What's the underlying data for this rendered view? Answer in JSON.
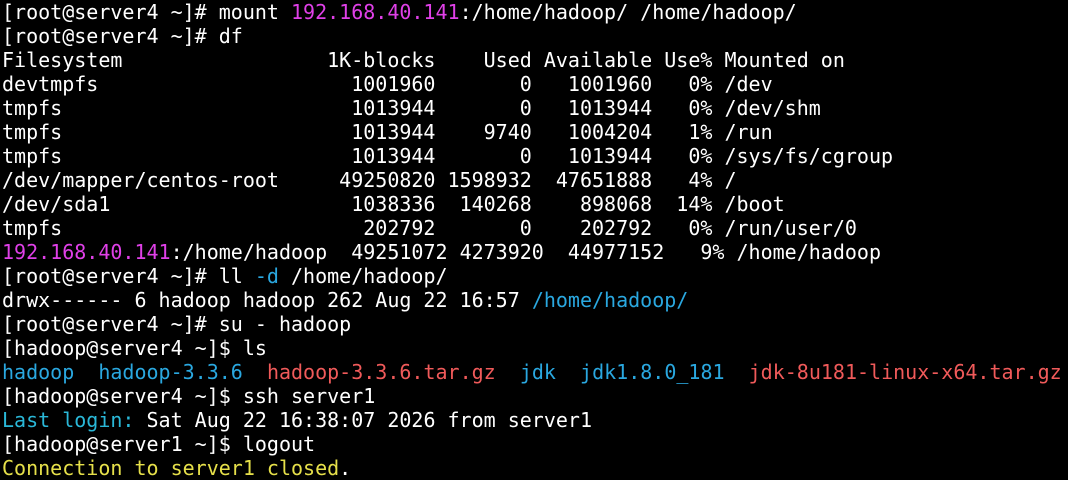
{
  "colors": {
    "background": "#000000",
    "foreground": "#ffffff",
    "ip_magenta": "#e040e8",
    "dir_blue": "#2aa8e0",
    "archive_red": "#f05a5a",
    "notice_yellow": "#e6e04a"
  },
  "lines": {
    "l1_prompt": "[root@server4 ~]# mount ",
    "l1_ip": "192.168.40.141",
    "l1_rest": ":/home/hadoop/ /home/hadoop/",
    "l2": "[root@server4 ~]# df",
    "l3": "Filesystem                 1K-blocks    Used Available Use% Mounted on",
    "l4": "devtmpfs                     1001960       0   1001960   0% /dev",
    "l5": "tmpfs                        1013944       0   1013944   0% /dev/shm",
    "l6": "tmpfs                        1013944    9740   1004204   1% /run",
    "l7": "tmpfs                        1013944       0   1013944   0% /sys/fs/cgroup",
    "l8": "/dev/mapper/centos-root     49250820 1598932  47651888   4% /",
    "l9": "/dev/sda1                    1038336  140268    898068  14% /boot",
    "l10": "tmpfs                         202792       0    202792   0% /run/user/0",
    "l11_ip": "192.168.40.141",
    "l11_rest": ":/home/hadoop  49251072 4273920  44977152   9% /home/hadoop",
    "l12_prompt": "[root@server4 ~]# ll ",
    "l12_flag": "-d",
    "l12_rest": " /home/hadoop/",
    "l13_prefix": "drwx------ 6 hadoop hadoop 262 Aug 22 16:57 ",
    "l13_dir": "/home/hadoop/",
    "l14": "[root@server4 ~]# su - hadoop",
    "l15": "[hadoop@server4 ~]$ ls",
    "l16_items": {
      "hadoop": "hadoop",
      "hadoop336": "hadoop-3.3.6",
      "tar": "hadoop-3.3.6.tar.gz",
      "jdk": "jdk",
      "jdk18": "jdk1.8.0_181",
      "jdktar": "jdk-8u181-linux-x64.tar.gz"
    },
    "l17": "[hadoop@server4 ~]$ ssh server1",
    "l18_label": "Last login:",
    "l18_rest": " Sat Aug 22 16:38:07 2026 from server1",
    "l19": "[hadoop@server1 ~]$ logout",
    "l20_text": "Connection to server1 closed",
    "l20_dot": "."
  }
}
